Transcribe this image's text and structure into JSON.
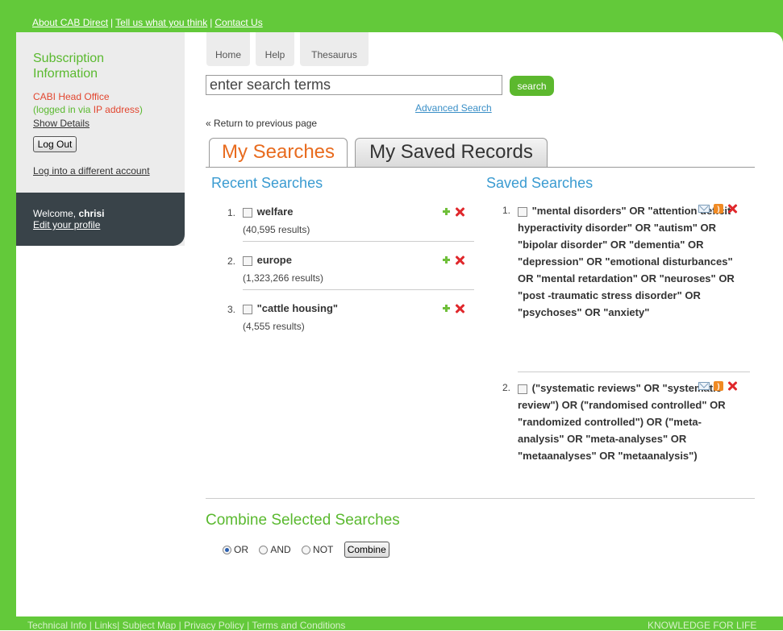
{
  "topbar": {
    "about": "About CAB Direct",
    "tell": "Tell us what you think",
    "contact": "Contact Us",
    "sep": "|"
  },
  "sidebar": {
    "subscription_title": "Subscription Information",
    "org": "CABI Head Office",
    "logged_prefix": "(logged in via ",
    "logged_ip": "IP address",
    "logged_suffix": ")",
    "show_details": "Show Details",
    "logout_label": "Log Out",
    "other_account": "Log into a different account",
    "welcome_prefix": "Welcome, ",
    "username": "chrisi",
    "edit_profile": "Edit your profile"
  },
  "nav": {
    "tabs": [
      {
        "label": "Home"
      },
      {
        "label": "Help"
      },
      {
        "label": "Thesaurus"
      }
    ]
  },
  "search": {
    "value": "enter search terms",
    "button_label": "search",
    "advanced": "Advanced Search"
  },
  "return_link": "« Return to previous page",
  "tabs": {
    "my_searches": "My Searches",
    "my_saved_records": "My Saved Records"
  },
  "recent": {
    "title": "Recent Searches",
    "items": [
      {
        "num": "1.",
        "name": "welfare",
        "count": "(40,595 results)"
      },
      {
        "num": "2.",
        "name": "europe",
        "count": "(1,323,266 results)"
      },
      {
        "num": "3.",
        "name": "\"cattle housing\"",
        "count": "(4,555 results)"
      }
    ]
  },
  "saved": {
    "title": "Saved Searches",
    "items": [
      {
        "num": "1.",
        "query": "\"mental disorders\" OR \"attention deficit hyperactivity disorder\" OR \"autism\" OR \"bipolar disorder\" OR \"dementia\" OR \"depression\" OR \"emotional disturbances\" OR \"mental retardation\" OR \"neuroses\" OR \"post -traumatic stress disorder\" OR \"psychoses\" OR \"anxiety\""
      },
      {
        "num": "2.",
        "query": "(\"systematic reviews\" OR \"systematic review\") OR (\"randomised controlled\" OR \"randomized controlled\") OR (\"meta-analysis\" OR \"meta-analyses\" OR \"metaanalyses\" OR \"metaanalysis\")"
      }
    ]
  },
  "combine": {
    "title": "Combine Selected Searches",
    "options": [
      "OR",
      "AND",
      "NOT"
    ],
    "selected": "OR",
    "button_label": "Combine"
  },
  "footer": {
    "links": "Technical Info | Links| Subject Map | Privacy Policy | Terms and Conditions",
    "tagline": "KNOWLEDGE FOR LIFE"
  },
  "colors": {
    "brand_green": "#63c93a",
    "accent_orange": "#e86b1e",
    "link_blue": "#3a9bd1",
    "delete_red": "#e0282c"
  }
}
